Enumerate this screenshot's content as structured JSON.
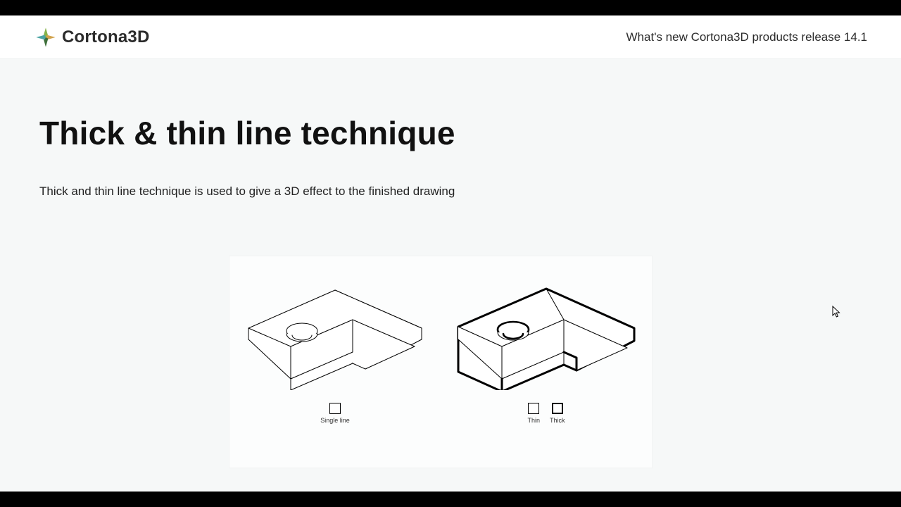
{
  "header": {
    "brand_name": "Cortona3D",
    "tagline": "What's new Cortona3D products release 14.1"
  },
  "slide": {
    "title": "Thick & thin line technique",
    "subtitle": "Thick and thin line technique is used to give a 3D effect to the finished drawing"
  },
  "legend": {
    "left_single": "Single line",
    "right_thin": "Thin",
    "right_thick": "Thick"
  }
}
